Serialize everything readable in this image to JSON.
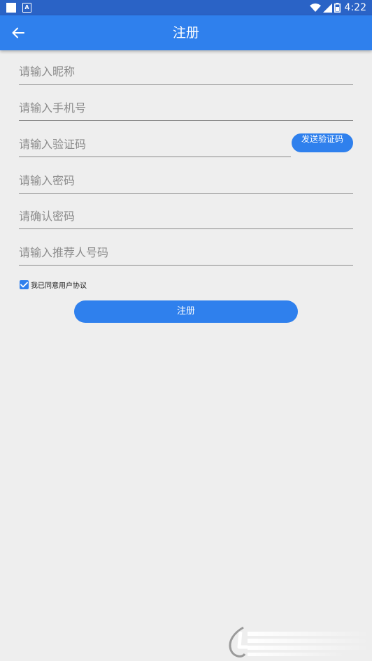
{
  "status_bar": {
    "time": "4:22",
    "icons": [
      "notification-square-icon",
      "a-icon",
      "wifi-icon",
      "signal-icon",
      "battery-icon"
    ]
  },
  "app_bar": {
    "title": "注册",
    "back_icon": "arrow-left-icon"
  },
  "form": {
    "nickname_placeholder": "请输入昵称",
    "phone_placeholder": "请输入手机号",
    "code_placeholder": "请输入验证码",
    "send_code_label": "发送验证码",
    "password_placeholder": "请输入密码",
    "confirm_password_placeholder": "请确认密码",
    "referrer_placeholder": "请输入推荐人号码",
    "agreement_label": "我已同意用户协议",
    "agreement_checked": true,
    "submit_label": "注册"
  },
  "colors": {
    "primary": "#2f80ed",
    "status_bar": "#2a63c6",
    "background": "#eeeeee"
  }
}
